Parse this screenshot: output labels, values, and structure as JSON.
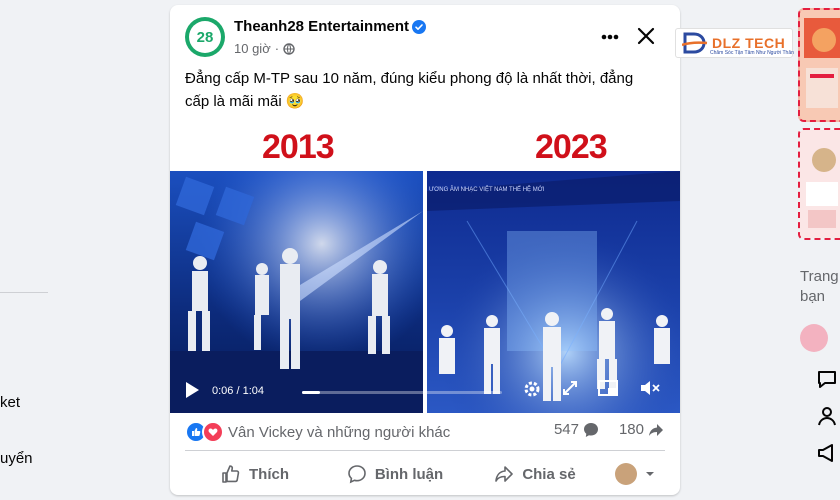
{
  "post": {
    "author": "Theanh28 Entertainment",
    "avatar_text": "28",
    "time": "10 giờ",
    "caption_line1": "Đẳng cấp M-TP sau 10 năm, đúng kiểu phong độ là nhất thời, đẳng",
    "caption_line2": "cấp là mãi mãi",
    "caption_emoji": "🥹",
    "media": {
      "year_left": "2013",
      "year_right": "2023",
      "stage_text": "ƯƠNG ÂM NHẠC VIỆT NAM THẾ HỆ MỚI",
      "time_current": "0:06",
      "time_total": "1:04",
      "progress_fraction": 0.09
    },
    "reactions": {
      "names": "Vân Vickey và những người khác",
      "comments": "547",
      "shares": "180"
    },
    "actions": {
      "like": "Thích",
      "comment": "Bình luận",
      "share": "Chia sẻ"
    }
  },
  "left_sidebar": {
    "item1": "ket",
    "item2": "uyển"
  },
  "right_sidebar": {
    "text1": "Trang",
    "text2": "bạn"
  },
  "watermark": {
    "title": "DLZ TECH",
    "subtitle": "Chăm Sóc Tận Tâm Như Người Thân"
  },
  "colors": {
    "facebook_blue": "#1877f2",
    "year_red": "#d0101a",
    "stage_blue": "#1a3fa8",
    "secondary_text": "#65676b"
  }
}
